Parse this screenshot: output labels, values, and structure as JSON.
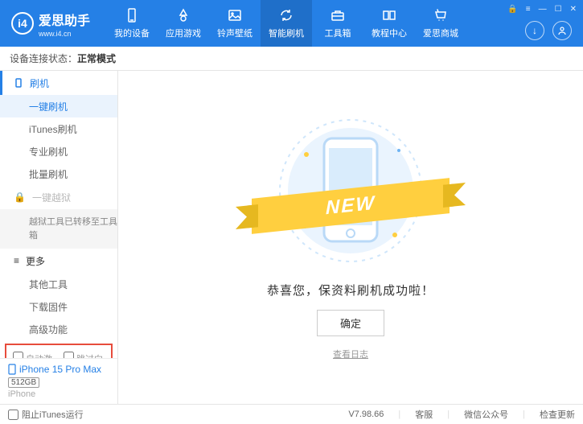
{
  "brand": {
    "name": "爱思助手",
    "url": "www.i4.cn",
    "mark": "i4"
  },
  "nav": {
    "items": [
      {
        "label": "我的设备"
      },
      {
        "label": "应用游戏"
      },
      {
        "label": "铃声壁纸"
      },
      {
        "label": "智能刷机"
      },
      {
        "label": "工具箱"
      },
      {
        "label": "教程中心"
      },
      {
        "label": "爱思商城"
      }
    ]
  },
  "status": {
    "label": "设备连接状态：",
    "value": "正常模式"
  },
  "sidebar": {
    "flash": {
      "head": "刷机",
      "items": [
        "一键刷机",
        "iTunes刷机",
        "专业刷机",
        "批量刷机"
      ]
    },
    "jailbreak": {
      "head": "一键越狱",
      "note": "越狱工具已转移至工具箱"
    },
    "more": {
      "head": "更多",
      "items": [
        "其他工具",
        "下载固件",
        "高级功能"
      ]
    },
    "checks": {
      "auto": "自动激活",
      "skip": "跳过向导"
    }
  },
  "device": {
    "name": "iPhone 15 Pro Max",
    "storage": "512GB",
    "type": "iPhone"
  },
  "main": {
    "ribbon": "NEW",
    "message": "恭喜您，保资料刷机成功啦！",
    "ok": "确定",
    "log": "查看日志"
  },
  "footer": {
    "block": "阻止iTunes运行",
    "version": "V7.98.66",
    "links": [
      "客服",
      "微信公众号",
      "检查更新"
    ]
  }
}
